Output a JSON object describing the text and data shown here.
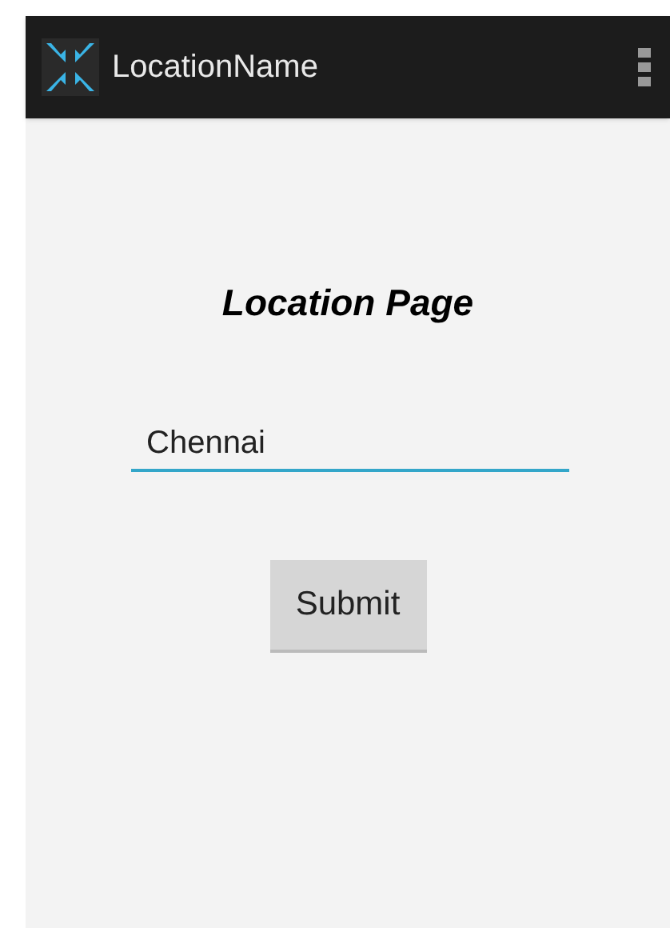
{
  "action_bar": {
    "title": "LocationName"
  },
  "heading": "Location Page",
  "location_field": {
    "value": "Chennai",
    "focused": true
  },
  "submit_button": {
    "label": "Submit"
  }
}
